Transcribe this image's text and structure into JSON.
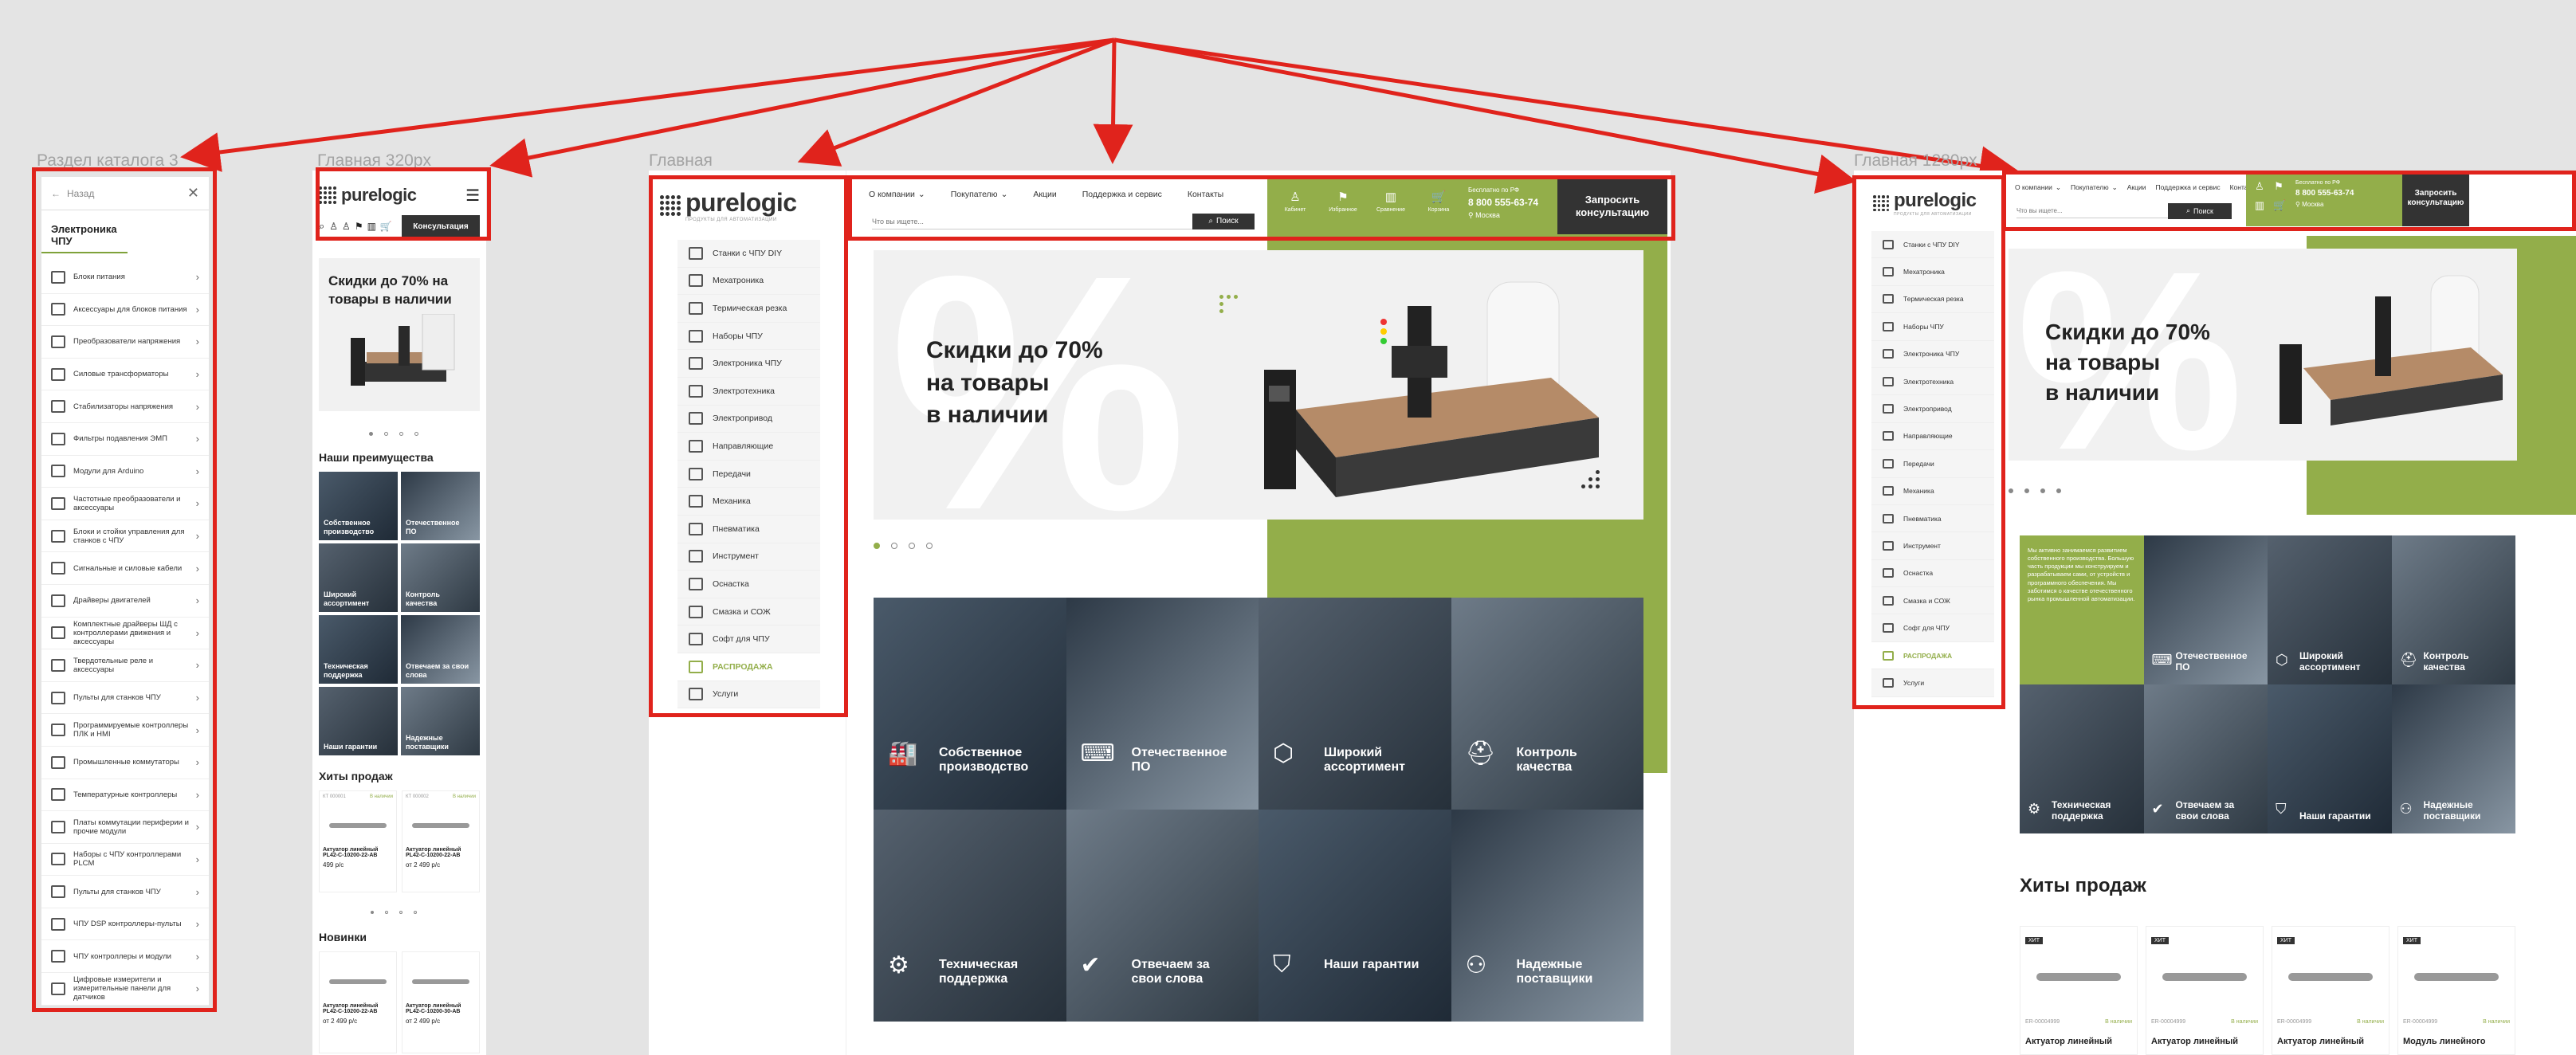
{
  "labels": {
    "catalog_section": "Раздел каталога 3",
    "mobile_home": "Главная 320px",
    "main_home": "Главная",
    "home_1280": "Главная 1280px"
  },
  "catalog": {
    "back": "Назад",
    "title": "Электроника ЧПУ",
    "items": [
      "Блоки питания",
      "Аксессуары для блоков питания",
      "Преобразователи напряжения",
      "Силовые трансформаторы",
      "Стабилизаторы напряжения",
      "Фильтры подавления ЭМП",
      "Модули для Arduino",
      "Частотные преобразователи и аксессуары",
      "Блоки и стойки управления для станков с ЧПУ",
      "Сигнальные и силовые кабели",
      "Драйверы двигателей",
      "Комплектные драйверы ШД с контроллерами движения и аксессуары",
      "Твердотельные реле и аксессуары",
      "Пульты для станков ЧПУ",
      "Программируемые контроллеры ПЛК и HMI",
      "Промышленные коммутаторы",
      "Температурные контроллеры",
      "Платы коммутации периферии и прочие модули",
      "Наборы с ЧПУ контроллерами PLCM",
      "Пульты для станков ЧПУ",
      "ЧПУ DSP контроллеры-пульты",
      "ЧПУ контроллеры и модули",
      "Цифровые измерители и измерительные панели для датчиков"
    ]
  },
  "brand": {
    "name": "purelogic",
    "tagline": "ПРОДУКТЫ ДЛЯ АВТОМАТИЗАЦИИ"
  },
  "mobile": {
    "consult_button": "Консультация",
    "hero": "Скидки до 70% на товары в наличии",
    "advantages_title": "Наши преимущества",
    "advantages": [
      "Собственное производство",
      "Отечественное ПО",
      "Широкий ассортимент",
      "Контроль качества",
      "Техническая поддержка",
      "Отвечаем за свои слова",
      "Наши гарантии",
      "Надежные поставщики"
    ],
    "hits_title": "Хиты продаж",
    "new_title": "Новинки",
    "products": [
      {
        "code": "КТ 000001",
        "stock": "В наличии",
        "name": "Актуатор линейный PL42-C-10200-22-AB",
        "price": "499 р/с"
      },
      {
        "code": "КТ 000002",
        "stock": "В наличии",
        "name": "Актуатор линейный PL42-C-10200-22-AB",
        "price": "от 2 499 р/с"
      }
    ],
    "new_products": [
      {
        "name": "Актуатор линейный PL42-C-10200-22-AB",
        "price": "от 2 499 р/с"
      },
      {
        "name": "Актуатор линейный PL42-C-10200-30-AB",
        "price": "от 2 499 р/с"
      }
    ]
  },
  "menu": [
    "Станки с ЧПУ DIY",
    "Мехатроника",
    "Термическая резка",
    "Наборы ЧПУ",
    "Электроника ЧПУ",
    "Электротехника",
    "Электропривод",
    "Направляющие",
    "Передачи",
    "Механика",
    "Пневматика",
    "Инструмент",
    "Оснастка",
    "Смазка и СОЖ",
    "Софт для ЧПУ",
    "РАСПРОДАЖА",
    "Услуги"
  ],
  "header": {
    "nav": [
      "О компании",
      "Покупателю",
      "Акции",
      "Поддержка и сервис",
      "Контакты"
    ],
    "search_placeholder": "Что вы ищете...",
    "search_button": "Поиск",
    "icons": [
      "Кабинет",
      "Избранное",
      "Сравнение",
      "Корзина"
    ],
    "phone_caption": "Бесплатно по РФ",
    "phone": "8 800 555-63-74",
    "city": "Москва",
    "consult": "Запросить консультацию"
  },
  "main": {
    "hero_line1": "Скидки до 70%",
    "hero_line2": "на товары",
    "hero_line3": "в наличии",
    "tiles": [
      "Собственное производство",
      "Отечественное ПО",
      "Широкий ассортимент",
      "Контроль качества",
      "Техническая поддержка",
      "Отвечаем за свои слова",
      "Наши гарантии",
      "Надежные поставщики"
    ]
  },
  "wide": {
    "about": "Мы активно занимаемся развитием собственного производства. Большую часть продукции мы конструируем и разрабатываем сами, от устройств и программного обеспечения. Мы заботимся о качестве отечественного рынка промышленной автоматизации.",
    "hits_title": "Хиты продаж",
    "products": [
      {
        "code": "ER-00004999",
        "stock": "В наличии",
        "name": "Актуатор линейный"
      },
      {
        "code": "ER-00004999",
        "stock": "В наличии",
        "name": "Актуатор линейный"
      },
      {
        "code": "ER-00004999",
        "stock": "В наличии",
        "name": "Актуатор линейный"
      },
      {
        "code": "ER-00004999",
        "stock": "В наличии",
        "name": "Модуль линейного"
      }
    ]
  },
  "colors": {
    "accent": "#93ae4a",
    "annotation": "#e0231c",
    "dark": "#333333"
  }
}
